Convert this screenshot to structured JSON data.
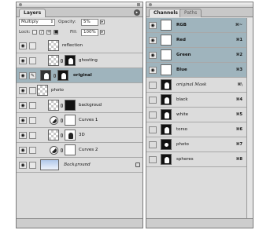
{
  "layers_panel": {
    "tab_label": "Layers",
    "blend_mode": "Multiply",
    "opacity_label": "Opacity:",
    "opacity_value": "5%",
    "lock_label": "Lock:",
    "fill_label": "Fill:",
    "fill_value": "100%",
    "layers": [
      {
        "name": "reflection"
      },
      {
        "name": "ghosting"
      },
      {
        "name": "original"
      },
      {
        "name": "photo"
      },
      {
        "name": "backgroud"
      },
      {
        "name": "Curves 1"
      },
      {
        "name": "3D"
      },
      {
        "name": "Curves 2"
      },
      {
        "name": "Background"
      }
    ]
  },
  "channels_panel": {
    "tab_channels": "Channels",
    "tab_paths": "Paths",
    "channels": [
      {
        "name": "RGB",
        "shortcut": "⌘~"
      },
      {
        "name": "Red",
        "shortcut": "⌘1"
      },
      {
        "name": "Green",
        "shortcut": "⌘2"
      },
      {
        "name": "Blue",
        "shortcut": "⌘3"
      },
      {
        "name": "original Mask",
        "shortcut": "⌘\\"
      },
      {
        "name": "black",
        "shortcut": "⌘4"
      },
      {
        "name": "white",
        "shortcut": "⌘5"
      },
      {
        "name": "torso",
        "shortcut": "⌘6"
      },
      {
        "name": "photo",
        "shortcut": "⌘7"
      },
      {
        "name": "spheres",
        "shortcut": "⌘8"
      }
    ]
  }
}
